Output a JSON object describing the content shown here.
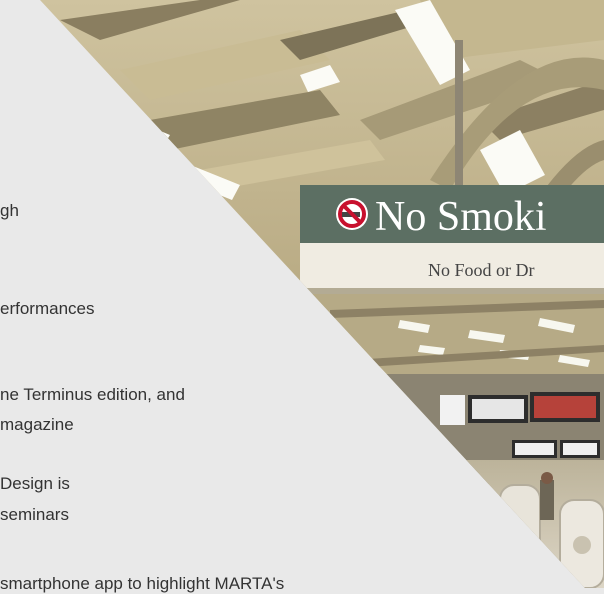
{
  "signage": {
    "primary": "No Smoki",
    "secondary": "No Food or Dr"
  },
  "text_lines": [
    "gh",
    "erformances",
    "ne Terminus edition, and",
    "magazine",
    "Design is",
    "seminars",
    "smartphone app to highlight MARTA's"
  ],
  "colors": {
    "panel_bg": "#e9e9e9",
    "text": "#333333",
    "sign_bg": "#5c6f63",
    "ceiling": "#d7cca6"
  },
  "icons": [
    "no-smoking-icon"
  ]
}
